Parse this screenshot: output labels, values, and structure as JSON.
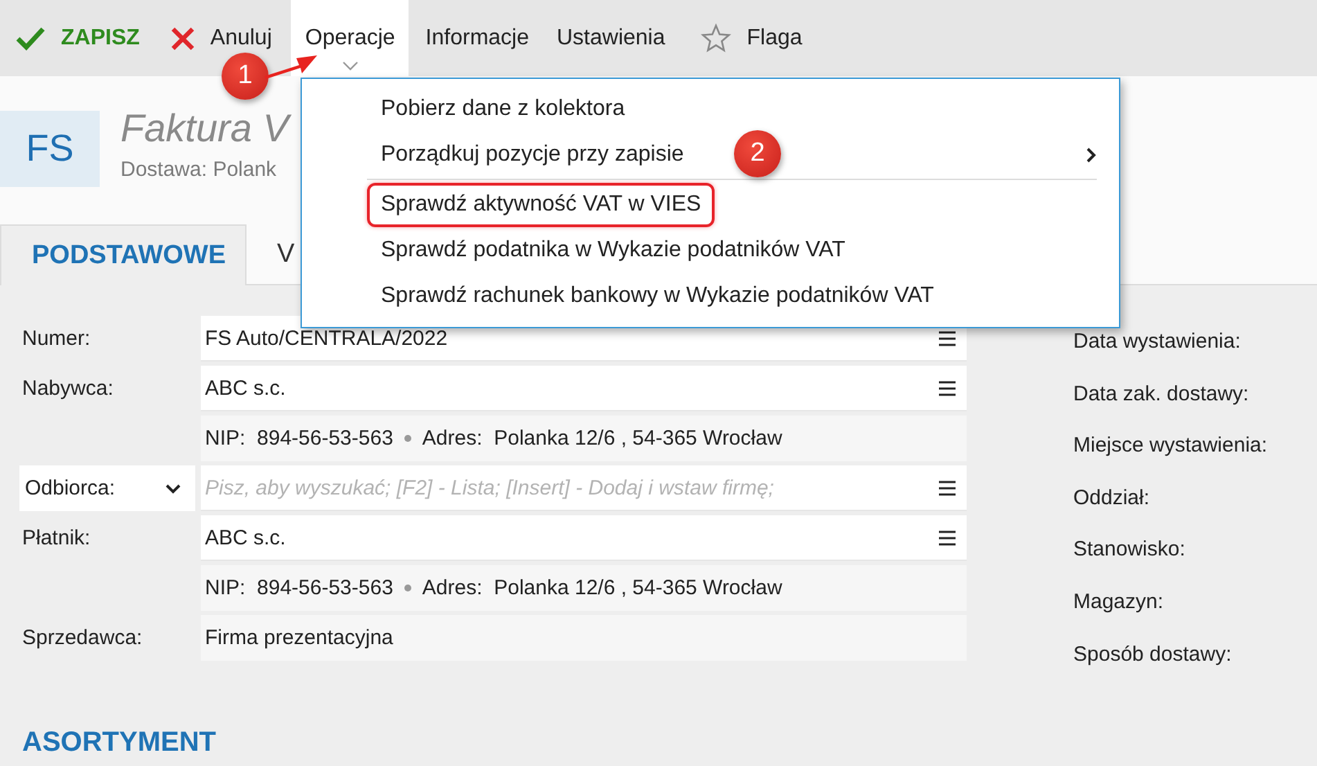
{
  "toolbar": [
    {
      "label": "ZAPISZ",
      "kind": "save",
      "selected": false
    },
    {
      "label": "Anuluj",
      "kind": "cancel",
      "selected": false
    },
    {
      "label": "Operacje",
      "kind": "dropdown",
      "selected": true
    },
    {
      "label": "Informacje",
      "kind": "plain",
      "selected": false
    },
    {
      "label": "Ustawienia",
      "kind": "plain",
      "selected": false
    },
    {
      "label": "Flaga",
      "kind": "flag",
      "selected": false
    }
  ],
  "header": {
    "badge": "FS",
    "title": "Faktura V",
    "subtitle": "Dostawa: Polank"
  },
  "tabs": [
    {
      "label": "PODSTAWOWE",
      "selected": true
    },
    {
      "label": "V",
      "selected": false
    }
  ],
  "menu": {
    "items": [
      {
        "label": "Pobierz dane z kolektora",
        "submenu": false,
        "separator_before": false,
        "highlighted": false
      },
      {
        "label": "Porządkuj pozycje przy zapisie",
        "submenu": true,
        "separator_before": false,
        "highlighted": false
      },
      {
        "label": "Sprawdź aktywność VAT w VIES",
        "submenu": false,
        "separator_before": true,
        "highlighted": true
      },
      {
        "label": "Sprawdź podatnika w Wykazie podatników VAT",
        "submenu": false,
        "separator_before": false,
        "highlighted": false
      },
      {
        "label": "Sprawdź rachunek bankowy w Wykazie podatników VAT",
        "submenu": false,
        "separator_before": false,
        "highlighted": false
      }
    ]
  },
  "form": {
    "rows": [
      {
        "label": "Numer:",
        "label_dropdown": false,
        "kind": "input",
        "value": "FS Auto/CENTRALA/2022"
      },
      {
        "label": "Nabywca:",
        "label_dropdown": false,
        "kind": "input",
        "value": "ABC s.c."
      },
      {
        "kind": "info",
        "nip_label": "NIP:",
        "nip": "894-56-53-563",
        "address_label": "Adres:",
        "address": "Polanka  12/6 , 54-365 Wrocław"
      },
      {
        "label": "Odbiorca:",
        "label_dropdown": true,
        "kind": "input",
        "placeholder": "Pisz, aby wyszukać; [F2] - Lista; [Insert] - Dodaj i wstaw firmę;"
      },
      {
        "label": "Płatnik:",
        "label_dropdown": false,
        "kind": "input",
        "value": "ABC s.c."
      },
      {
        "kind": "info",
        "nip_label": "NIP:",
        "nip": "894-56-53-563",
        "address_label": "Adres:",
        "address": "Polanka  12/6 , 54-365 Wrocław"
      },
      {
        "label": "Sprzedawca:",
        "label_dropdown": false,
        "kind": "readonly",
        "value": "Firma prezentacyjna"
      }
    ],
    "side_labels": [
      "Data wystawienia:",
      "Data zak. dostawy:",
      "Miejsce wystawienia:",
      "Oddział:",
      "Stanowisko:",
      "Magazyn:",
      "Sposób dostawy:"
    ]
  },
  "section_title": "ASORTYMENT",
  "annotations": [
    {
      "label": "1"
    },
    {
      "label": "2"
    }
  ]
}
